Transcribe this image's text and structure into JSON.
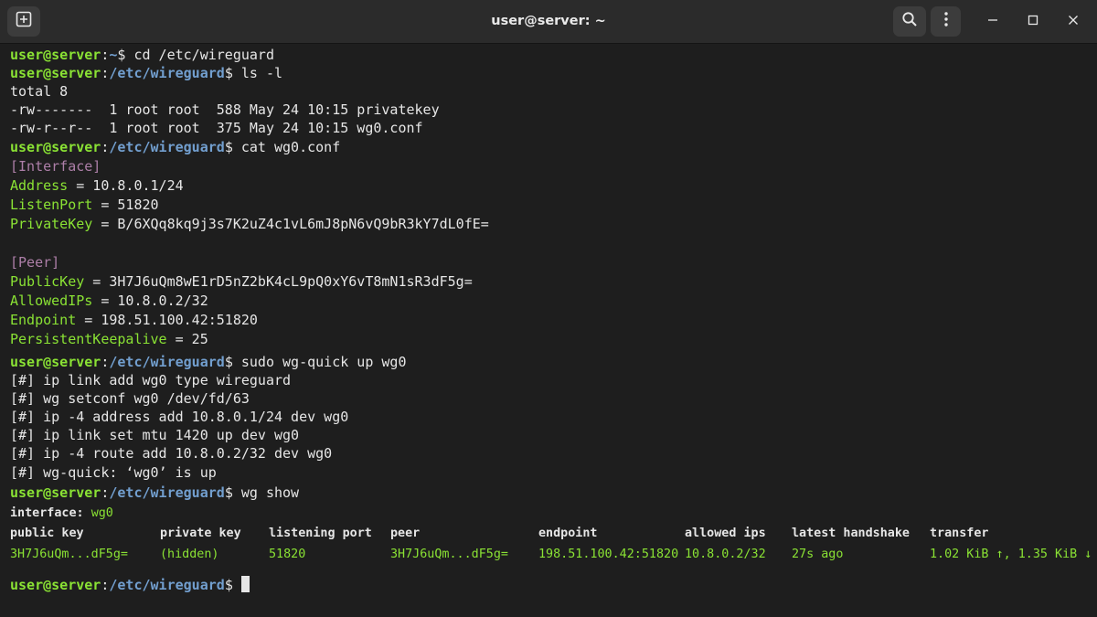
{
  "window": {
    "title": "user@server: ~"
  },
  "prompt": {
    "user_host": "user@server",
    "sep": ":",
    "home": "~",
    "dir": "/etc/wireguard",
    "symbol": "$ "
  },
  "commands": {
    "cd": "cd /etc/wireguard",
    "ls": "ls -l",
    "cat": "cat wg0.conf",
    "up": "sudo wg-quick up wg0",
    "show": "wg show"
  },
  "ls_output": {
    "total": "total 8",
    "files": [
      "-rw-------  1 root root  588 May 24 10:15 privatekey",
      "-rw-r--r--  1 root root  375 May 24 10:15 wg0.conf"
    ]
  },
  "config": {
    "interface_header": "[Interface]",
    "interface": [
      {
        "key": "Address",
        "value": " = 10.8.0.1/24"
      },
      {
        "key": "ListenPort",
        "value": " = 51820"
      },
      {
        "key": "PrivateKey",
        "value": " = B/6XQq8kq9j3s7K2uZ4c1vL6mJ8pN6vQ9bR3kY7dL0fE="
      }
    ],
    "peer_header": "[Peer]",
    "peer": [
      {
        "key": "PublicKey",
        "value": " = 3H7J6uQm8wE1rD5nZ2bK4cL9pQ0xY6vT8mN1sR3dF5g="
      },
      {
        "key": "AllowedIPs",
        "value": " = 10.8.0.2/32"
      },
      {
        "key": "Endpoint",
        "value": " = 198.51.100.42:51820"
      },
      {
        "key": "PersistentKeepalive",
        "value": " = 25"
      }
    ]
  },
  "wgquick_output": [
    "[#] ip link add wg0 type wireguard",
    "[#] wg setconf wg0 /dev/fd/63",
    "[#] ip -4 address add 10.8.0.1/24 dev wg0",
    "[#] ip link set mtu 1420 up dev wg0",
    "[#] ip -4 route add 10.8.0.2/32 dev wg0",
    "[#] wg-quick: ‘wg0’ is up"
  ],
  "wg_show": {
    "interface_label": "interface: ",
    "interface_name": "wg0",
    "headers": [
      "public key",
      "private key",
      "listening port",
      "peer",
      "endpoint",
      "allowed ips",
      "latest handshake",
      "transfer"
    ],
    "values": [
      "3H7J6uQm...dF5g=",
      "(hidden)",
      "51820",
      "3H7J6uQm...dF5g=",
      "198.51.100.42:51820",
      "10.8.0.2/32",
      "27s ago",
      "1.02 KiB ↑, 1.35 KiB ↓"
    ]
  },
  "icons": {
    "new_tab": "new-tab-icon",
    "search": "search-icon",
    "menu": "menu-icon",
    "minimize": "minimize-icon",
    "maximize": "maximize-icon",
    "close": "close-icon"
  },
  "colors": {
    "background": "#1e1e1e",
    "titlebar": "#2b2b2b",
    "prompt_user": "#8ae234",
    "prompt_path": "#729fcf",
    "section_header": "#ad7fa8",
    "text": "#e6e6e6"
  }
}
